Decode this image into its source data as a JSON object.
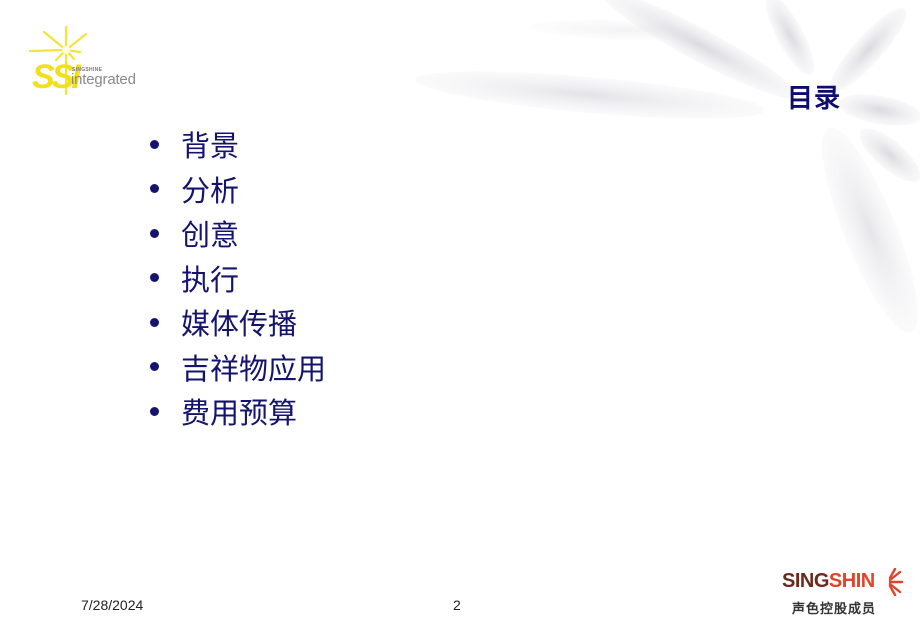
{
  "slide": {
    "title": "目录",
    "agenda_items": [
      {
        "label": "背景"
      },
      {
        "label": "分析"
      },
      {
        "label": "创意"
      },
      {
        "label": "执行"
      },
      {
        "label": "媒体传播"
      },
      {
        "label": "吉祥物应用"
      },
      {
        "label": "费用预算"
      }
    ],
    "footer": {
      "date": "7/28/2024",
      "page_number": "2"
    }
  },
  "logos": {
    "ssi": {
      "letters": "SSI",
      "brand_small": "SINGSHINE",
      "tagline": "integrated"
    },
    "singshine": {
      "part1": "SING",
      "part2": "SHIN",
      "subtitle": "声色控股成员"
    }
  },
  "colors": {
    "title": "#0d0d6e",
    "text": "#14146e",
    "ssi_yellow": "#f2e01a",
    "singshine_dark": "#6b2a1e",
    "singshine_red": "#e0442a",
    "burst_gray": "#d6d6dc"
  }
}
